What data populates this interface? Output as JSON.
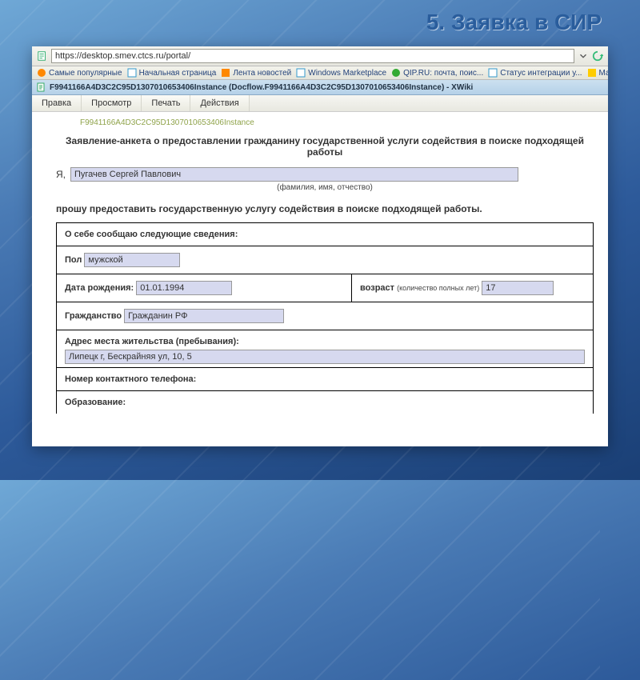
{
  "slide": {
    "title": "5. Заявка в СИР"
  },
  "address": {
    "url": "https://desktop.smev.ctcs.ru/portal/"
  },
  "bookmarks": [
    {
      "label": "Самые популярные"
    },
    {
      "label": "Начальная страница"
    },
    {
      "label": "Лента новостей"
    },
    {
      "label": "Windows Marketplace"
    },
    {
      "label": "QIP.RU: почта, поис..."
    },
    {
      "label": "Статус интеграции у..."
    },
    {
      "label": "Mail AT"
    }
  ],
  "window_title": "F9941166A4D3C2C95D1307010653406Instance (Docflow.F9941166A4D3C2C95D1307010653406Instance) - XWiki",
  "menu": [
    "Правка",
    "Просмотр",
    "Печать",
    "Действия"
  ],
  "instance_label": "F9941166A4D3C2C95D1307010653406Instance",
  "form": {
    "title": "Заявление-анкета о предоставлении гражданину государственной услуги содействия в поиске подходящей работы",
    "ya": "Я,",
    "fio": "Пугачев Сергей Павлович",
    "fio_caption": "(фамилия, имя, отчество)",
    "ask": "прошу предоставить государственную услугу содействия в поиске подходящей работы.",
    "about_head": "О себе сообщаю следующие сведения:",
    "gender_label": "Пол",
    "gender": "мужской",
    "dob_label": "Дата рождения:",
    "dob": "01.01.1994",
    "age_label": "возраст",
    "age_note": "(количество полных лет)",
    "age": "17",
    "citizenship_label": "Гражданство",
    "citizenship": "Гражданин РФ",
    "address_label": "Адрес места жительства (пребывания):",
    "address": "Липецк г, Бескрайняя ул, 10, 5",
    "phone_label": "Номер контактного телефона:",
    "edu_label": "Образование:"
  }
}
